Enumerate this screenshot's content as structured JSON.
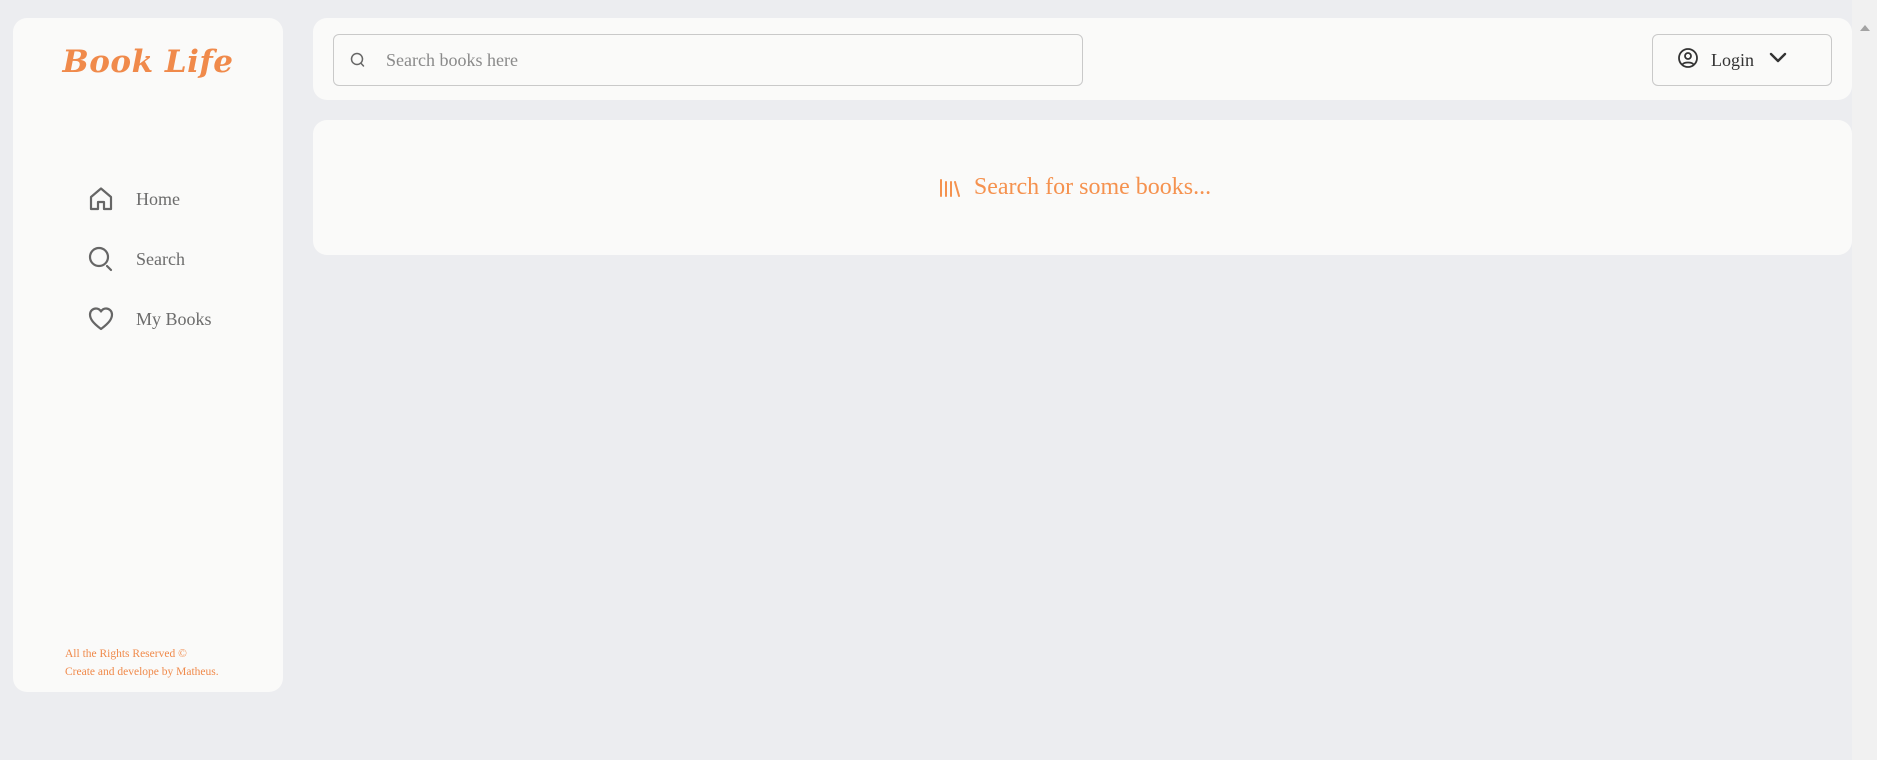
{
  "sidebar": {
    "logo": "Book Life",
    "items": [
      {
        "label": "Home",
        "icon": "home-icon"
      },
      {
        "label": "Search",
        "icon": "search-icon"
      },
      {
        "label": "My Books",
        "icon": "heart-icon"
      }
    ],
    "footer_line1": "All the Rights Reserved ©",
    "footer_line2": "Create and develope by Matheus."
  },
  "header": {
    "search_placeholder": "Search books here",
    "search_value": "",
    "login_label": "Login"
  },
  "main": {
    "empty_message": "Search for some books..."
  },
  "colors": {
    "accent": "#f08a4b",
    "panel": "#fafaf9",
    "background": "#ecedf0",
    "text_muted": "#6c6c6c"
  }
}
